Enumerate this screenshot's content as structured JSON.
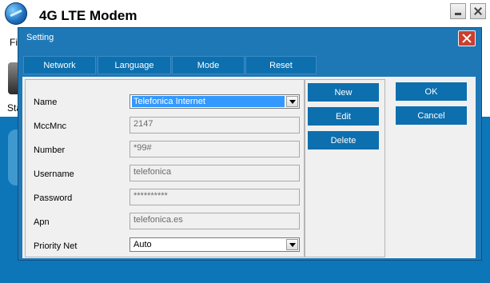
{
  "app": {
    "title": "4G LTE Modem",
    "menu_stub": "Fi",
    "status_stub": "Sta"
  },
  "dialog": {
    "title": "Setting",
    "tabs": [
      "Network",
      "Language",
      "Mode",
      "Reset"
    ],
    "form": {
      "name_label": "Name",
      "name_value": "Telefonica Internet",
      "mccmnc_label": "MccMnc",
      "mccmnc_value": "2147",
      "number_label": "Number",
      "number_value": "*99#",
      "username_label": "Username",
      "username_value": "telefonica",
      "password_label": "Password",
      "password_value": "**********",
      "apn_label": "Apn",
      "apn_value": "telefonica.es",
      "priority_label": "Priority Net",
      "priority_value": "Auto"
    },
    "profile_buttons": {
      "new": "New",
      "edit": "Edit",
      "delete": "Delete"
    },
    "ok": "OK",
    "cancel": "Cancel"
  },
  "colors": {
    "dialog_blue": "#1f78b6",
    "button_blue": "#0d6fae",
    "selection": "#3399ff",
    "close_red": "#c9402e"
  }
}
